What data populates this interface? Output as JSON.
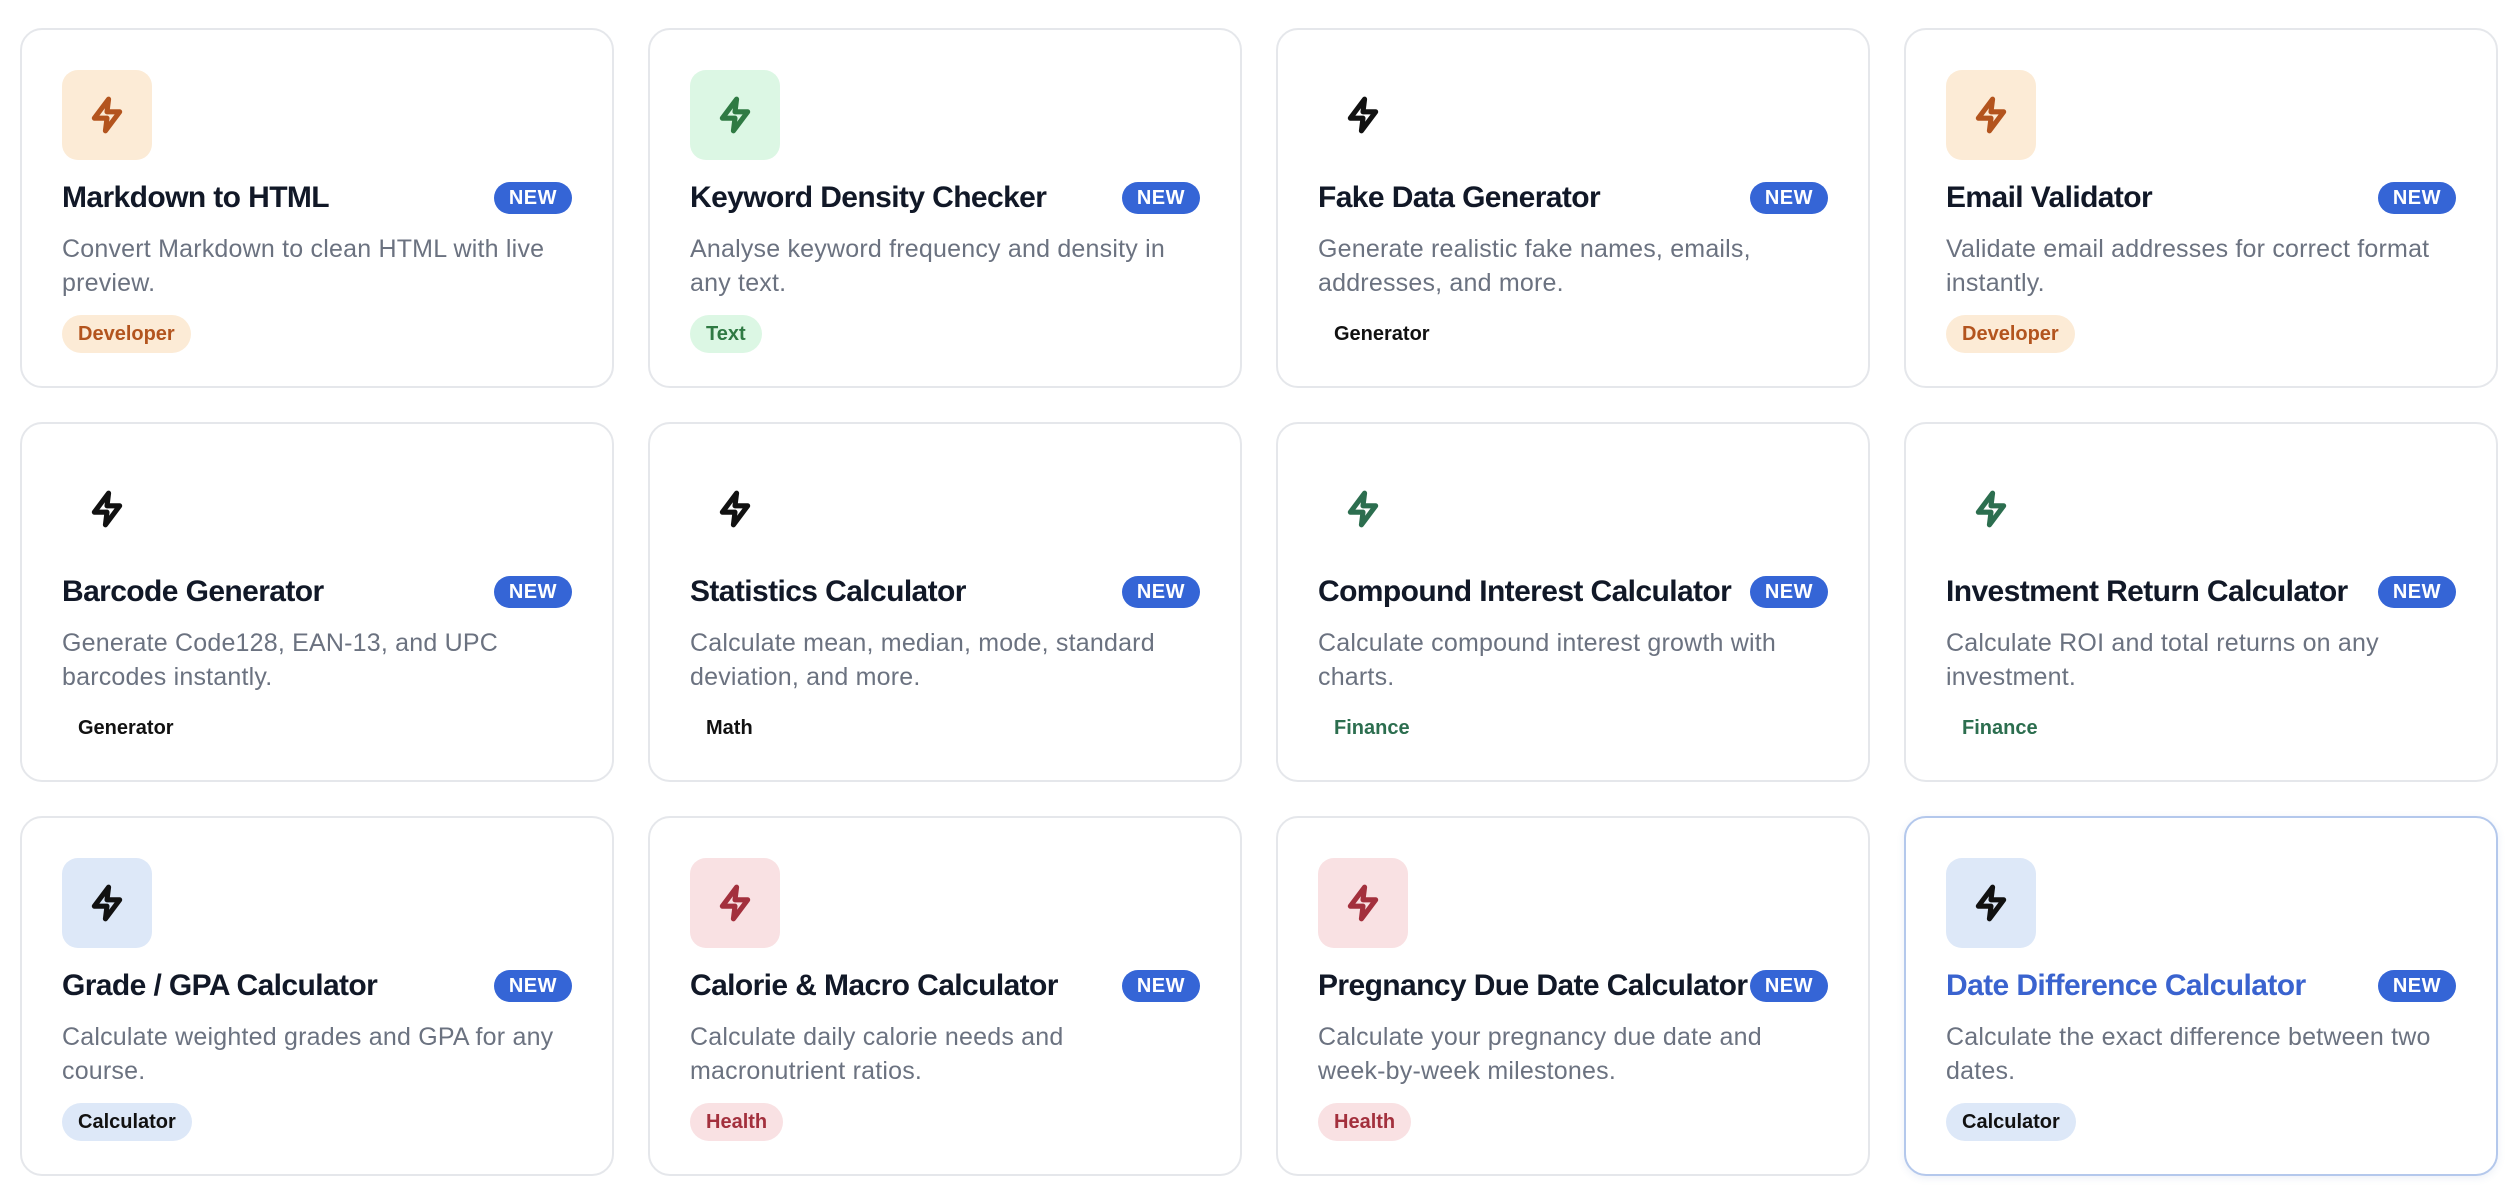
{
  "theme": {
    "new_badge_color": "#3565d6",
    "active_title_color": "#3a63cf"
  },
  "cards": [
    {
      "title": "Markdown to HTML",
      "badge": "NEW",
      "description": "Convert Markdown to clean HTML with live preview.",
      "tag": "Developer",
      "icon": "lightning-icon",
      "icon_bg": "#fcebd6",
      "icon_color": "#b3541e",
      "tag_bg": "#fcebd6",
      "tag_color": "#b3541e"
    },
    {
      "title": "Keyword Density Checker",
      "badge": "NEW",
      "description": "Analyse keyword frequency and density in any text.",
      "tag": "Text",
      "icon": "lightning-icon",
      "icon_bg": "#dcf7e4",
      "icon_color": "#2f7a43",
      "tag_bg": "#dcf7e4",
      "tag_color": "#2f7a43"
    },
    {
      "title": "Fake Data Generator",
      "badge": "NEW",
      "description": "Generate realistic fake names, emails, addresses, and more.",
      "tag": "Generator",
      "icon": "lightning-icon",
      "icon_bg": "transparent",
      "icon_color": "#111111",
      "tag_bg": "transparent",
      "tag_color": "#111111"
    },
    {
      "title": "Email Validator",
      "badge": "NEW",
      "description": "Validate email addresses for correct format instantly.",
      "tag": "Developer",
      "icon": "lightning-icon",
      "icon_bg": "#fcebd6",
      "icon_color": "#b3541e",
      "tag_bg": "#fcebd6",
      "tag_color": "#b3541e"
    },
    {
      "title": "Barcode Generator",
      "badge": "NEW",
      "description": "Generate Code128, EAN-13, and UPC barcodes instantly.",
      "tag": "Generator",
      "icon": "lightning-icon",
      "icon_bg": "transparent",
      "icon_color": "#111111",
      "tag_bg": "transparent",
      "tag_color": "#111111"
    },
    {
      "title": "Statistics Calculator",
      "badge": "NEW",
      "description": "Calculate mean, median, mode, standard deviation, and more.",
      "tag": "Math",
      "icon": "lightning-icon",
      "icon_bg": "transparent",
      "icon_color": "#111111",
      "tag_bg": "transparent",
      "tag_color": "#111111"
    },
    {
      "title": "Compound Interest Calculator",
      "badge": "NEW",
      "description": "Calculate compound interest growth with charts.",
      "tag": "Finance",
      "icon": "lightning-icon",
      "icon_bg": "transparent",
      "icon_color": "#2c6e4f",
      "tag_bg": "transparent",
      "tag_color": "#2c6e4f"
    },
    {
      "title": "Investment Return Calculator",
      "badge": "NEW",
      "description": "Calculate ROI and total returns on any investment.",
      "tag": "Finance",
      "icon": "lightning-icon",
      "icon_bg": "transparent",
      "icon_color": "#2c6e4f",
      "tag_bg": "transparent",
      "tag_color": "#2c6e4f"
    },
    {
      "title": "Grade / GPA Calculator",
      "badge": "NEW",
      "description": "Calculate weighted grades and GPA for any course.",
      "tag": "Calculator",
      "icon": "lightning-icon",
      "icon_bg": "#dde8f8",
      "icon_color": "#111111",
      "tag_bg": "#dde8f8",
      "tag_color": "#111111"
    },
    {
      "title": "Calorie & Macro Calculator",
      "badge": "NEW",
      "description": "Calculate daily calorie needs and macronutrient ratios.",
      "tag": "Health",
      "icon": "lightning-icon",
      "icon_bg": "#f9e1e3",
      "icon_color": "#a3303d",
      "tag_bg": "#f9e1e3",
      "tag_color": "#a3303d"
    },
    {
      "title": "Pregnancy Due Date Calculator",
      "badge": "NEW",
      "description": "Calculate your pregnancy due date and week-by-week milestones.",
      "tag": "Health",
      "icon": "lightning-icon",
      "icon_bg": "#f9e1e3",
      "icon_color": "#a3303d",
      "tag_bg": "#f9e1e3",
      "tag_color": "#a3303d"
    },
    {
      "title": "Date Difference Calculator",
      "badge": "NEW",
      "description": "Calculate the exact difference between two dates.",
      "tag": "Calculator",
      "icon": "lightning-icon",
      "icon_bg": "#dde8f8",
      "icon_color": "#111111",
      "tag_bg": "#dde8f8",
      "tag_color": "#111111",
      "active": true
    }
  ]
}
